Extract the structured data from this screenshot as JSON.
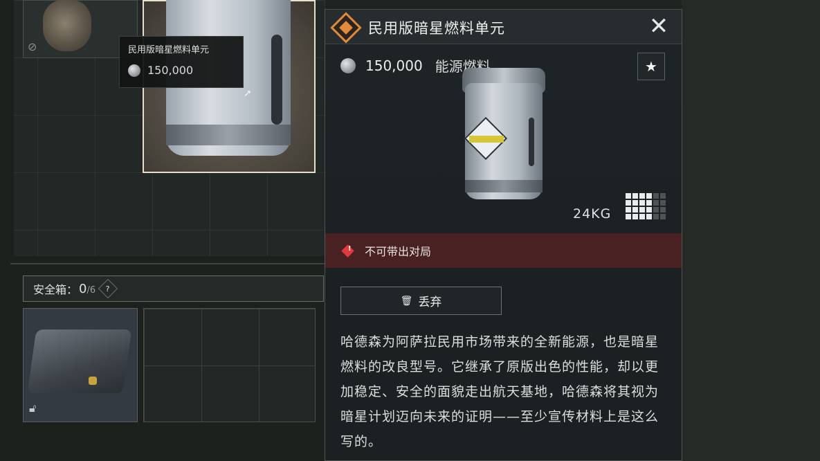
{
  "tooltip": {
    "name": "民用版暗星燃料单元",
    "price": "150,000"
  },
  "safe_box": {
    "label": "安全箱：",
    "count": "0",
    "capacity": "/6",
    "help": "?"
  },
  "detail": {
    "title": "民用版暗星燃料单元",
    "price": "150,000",
    "category": "能源燃料",
    "favorite": "★",
    "close": "✕",
    "weight": "24KG",
    "size_grid": {
      "cols": 6,
      "rows": 4,
      "filled_cols": 4
    },
    "warning": "不可带出对局",
    "discard_label": "丢弃",
    "description": "哈德森为阿萨拉民用市场带来的全新能源，也是暗星燃料的改良型号。它继承了原版出色的性能，却以更加稳定、安全的面貌走出航天基地，哈德森将其视为暗星计划迈向未来的证明——至少宣传材料上是这么写的。"
  },
  "colors": {
    "rarity": "#e08a3a",
    "warning_bg": "#4a2123",
    "warning_icon": "#e03a3a",
    "panel_bg": "#1b2022"
  },
  "icons": [
    "rarity-diamond-icon",
    "close-icon",
    "coin-icon",
    "star-icon",
    "warning-icon",
    "trash-icon",
    "help-icon",
    "lock-icon",
    "no-swap-icon",
    "cursor-icon"
  ]
}
